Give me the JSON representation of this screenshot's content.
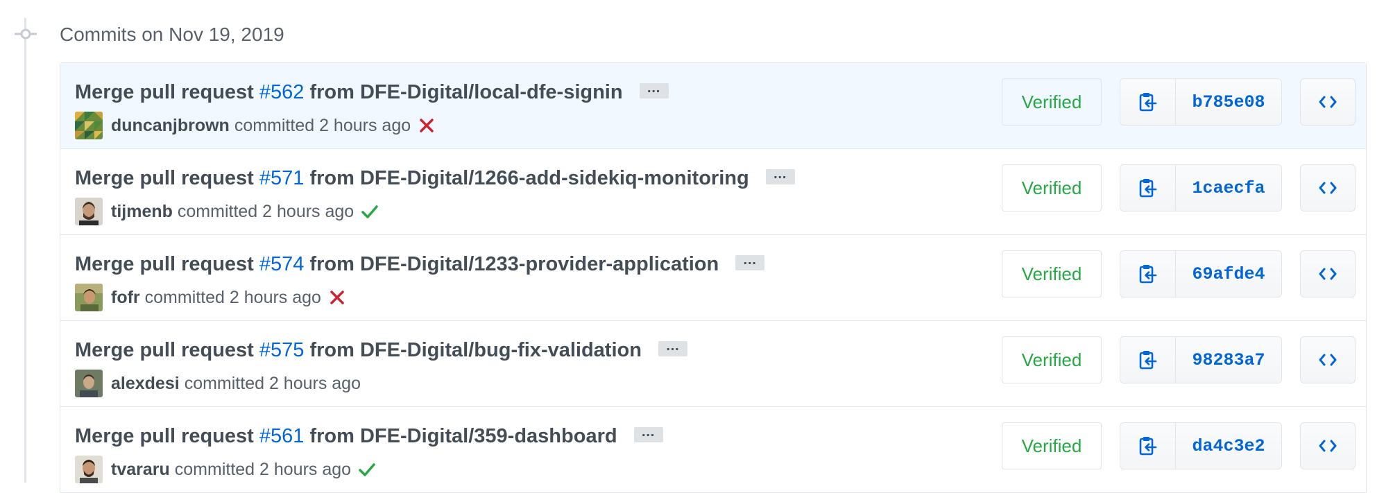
{
  "group_title": "Commits on Nov 19, 2019",
  "colors": {
    "link": "#0366d6",
    "verified": "#28a745",
    "failure": "#cb2431",
    "success": "#28a745"
  },
  "commits": [
    {
      "prefix": "Merge pull request",
      "pr": "#562",
      "branch": "from DFE-Digital/local-dfe-signin",
      "ellipsis": "…",
      "author": "duncanjbrown",
      "committed": "committed 2 hours ago",
      "status": "failure",
      "verified": "Verified",
      "sha": "b785e08",
      "avatar_icon": "avatar-pattern-icon"
    },
    {
      "prefix": "Merge pull request",
      "pr": "#571",
      "branch": "from DFE-Digital/1266-add-sidekiq-monitoring",
      "ellipsis": "…",
      "author": "tijmenb",
      "committed": "committed 2 hours ago",
      "status": "success",
      "verified": "Verified",
      "sha": "1caecfa",
      "avatar_icon": "avatar-photo-icon"
    },
    {
      "prefix": "Merge pull request",
      "pr": "#574",
      "branch": "from DFE-Digital/1233-provider-application",
      "ellipsis": "…",
      "author": "fofr",
      "committed": "committed 2 hours ago",
      "status": "failure",
      "verified": "Verified",
      "sha": "69afde4",
      "avatar_icon": "avatar-photo-icon"
    },
    {
      "prefix": "Merge pull request",
      "pr": "#575",
      "branch": "from DFE-Digital/bug-fix-validation",
      "ellipsis": "…",
      "author": "alexdesi",
      "committed": "committed 2 hours ago",
      "status": "none",
      "verified": "Verified",
      "sha": "98283a7",
      "avatar_icon": "avatar-photo-icon"
    },
    {
      "prefix": "Merge pull request",
      "pr": "#561",
      "branch": "from DFE-Digital/359-dashboard",
      "ellipsis": "…",
      "author": "tvararu",
      "committed": "committed 2 hours ago",
      "status": "success",
      "verified": "Verified",
      "sha": "da4c3e2",
      "avatar_icon": "avatar-photo-icon"
    }
  ]
}
